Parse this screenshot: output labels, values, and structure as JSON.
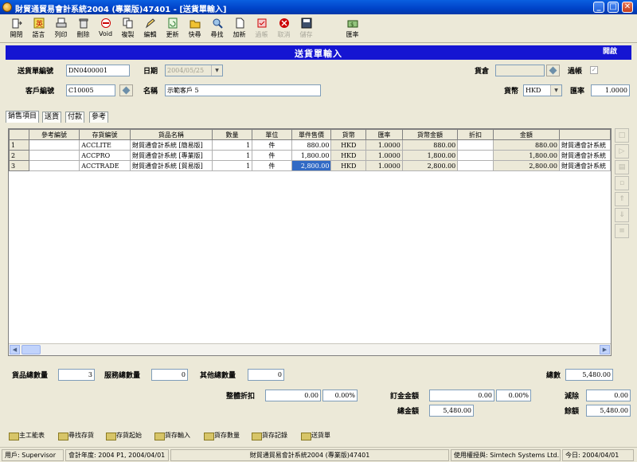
{
  "window": {
    "title": "財貿通貿易會計系統2004 (專業版)47401 - [送貨單輸入]",
    "min": "_",
    "max": "□",
    "close": "✕"
  },
  "toolbar": [
    {
      "label": "開閉",
      "icon": "open-close-icon",
      "enabled": true
    },
    {
      "label": "語言",
      "icon": "language-icon",
      "enabled": true
    },
    {
      "label": "列印",
      "icon": "print-icon",
      "enabled": true
    },
    {
      "label": "刪除",
      "icon": "delete-icon",
      "enabled": true
    },
    {
      "label": "Void",
      "icon": "void-icon",
      "enabled": true
    },
    {
      "label": "複製",
      "icon": "copy-icon",
      "enabled": true
    },
    {
      "label": "編輯",
      "icon": "edit-icon",
      "enabled": true
    },
    {
      "label": "更新",
      "icon": "refresh-icon",
      "enabled": true
    },
    {
      "label": "快尋",
      "icon": "quick-find-icon",
      "enabled": true
    },
    {
      "label": "尋找",
      "icon": "search-icon",
      "enabled": true
    },
    {
      "label": "加新",
      "icon": "new-icon",
      "enabled": true
    },
    {
      "label": "過帳",
      "icon": "post-icon",
      "enabled": false
    },
    {
      "label": "取消",
      "icon": "cancel-icon",
      "enabled": false
    },
    {
      "label": "儲存",
      "icon": "save-icon",
      "enabled": false
    },
    {
      "label": "匯率",
      "icon": "exchange-rate-icon",
      "enabled": true
    }
  ],
  "header": {
    "caption": "送貨單輸入",
    "status": "開啟",
    "doc_no_label": "送貨單編號",
    "doc_no": "DN0400001",
    "date_label": "日期",
    "date": "2004/05/25",
    "warehouse_label": "貨倉",
    "warehouse": "",
    "posted_label": "過帳",
    "posted_mark": "✓",
    "customer_label": "客戶編號",
    "customer_no": "C10005",
    "name_label": "名稱",
    "customer_name": "示範客戶 5",
    "currency_label": "貨幣",
    "currency": "HKD",
    "rate_label": "匯率",
    "rate": "1.0000"
  },
  "tabs": [
    "銷售項目",
    "送貨",
    "付款",
    "參考"
  ],
  "grid": {
    "columns": [
      "參考編號",
      "存貨編號",
      "貨品名稱",
      "數量",
      "單位",
      "單件售價",
      "貨幣",
      "匯率",
      "貨幣金額",
      "折扣",
      "金額",
      ""
    ],
    "rows": [
      {
        "no": "1",
        "ref": "",
        "item": "ACCLITE",
        "name": "財貿通會計系統 [簡易版]",
        "qty": "1",
        "unit": "件",
        "price": "880.00",
        "cur": "HKD",
        "rate": "1.0000",
        "cur_amt": "880.00",
        "disc": "",
        "amt": "880.00",
        "desc": "財貿通會計系統"
      },
      {
        "no": "2",
        "ref": "",
        "item": "ACCPRO",
        "name": "財貿通會計系統 [專業版]",
        "qty": "1",
        "unit": "件",
        "price": "1,800.00",
        "cur": "HKD",
        "rate": "1.0000",
        "cur_amt": "1,800.00",
        "disc": "",
        "amt": "1,800.00",
        "desc": "財貿通會計系統"
      },
      {
        "no": "3",
        "ref": "",
        "item": "ACCTRADE",
        "name": "財貿通會計系統 [貿易版]",
        "qty": "1",
        "unit": "件",
        "price": "2,800.00",
        "cur": "HKD",
        "rate": "1.0000",
        "cur_amt": "2,800.00",
        "disc": "",
        "amt": "2,800.00",
        "desc": "財貿通會計系統"
      }
    ]
  },
  "side_buttons": [
    "append-row-icon",
    "insert-row-icon",
    "copy-row-icon",
    "delete-row-icon",
    "move-up-icon",
    "move-down-icon",
    "sort-icon"
  ],
  "totals": {
    "goods_qty_label": "貨品總數量",
    "goods_qty": "3",
    "service_qty_label": "服務總數量",
    "service_qty": "0",
    "other_qty_label": "其他總數量",
    "other_qty": "0",
    "total_label": "總數",
    "total": "5,480.00",
    "overall_disc_label": "整體折扣",
    "overall_disc": "0.00",
    "overall_disc_pct": "0.00%",
    "deposit_label": "訂金金額",
    "deposit": "0.00",
    "deposit_pct": "0.00%",
    "less_label": "減除",
    "less": "0.00",
    "grand_label": "總金額",
    "grand": "5,480.00",
    "balance_label": "餘額",
    "balance": "5,480.00"
  },
  "bottom_buttons": [
    "主工能表",
    "尋找存貨",
    "存貨起始",
    "貨存輸入",
    "貨存數量",
    "貨存記錄",
    "送貨單"
  ],
  "status": {
    "user": "用戶: Supervisor",
    "period": "會計年度: 2004 P1, 2004/04/01",
    "product": "財貿通貿易會計系統2004 (專業版)47401",
    "licensee": "使用權授與: Simtech Systems Ltd.",
    "today": "今日: 2004/04/01"
  }
}
